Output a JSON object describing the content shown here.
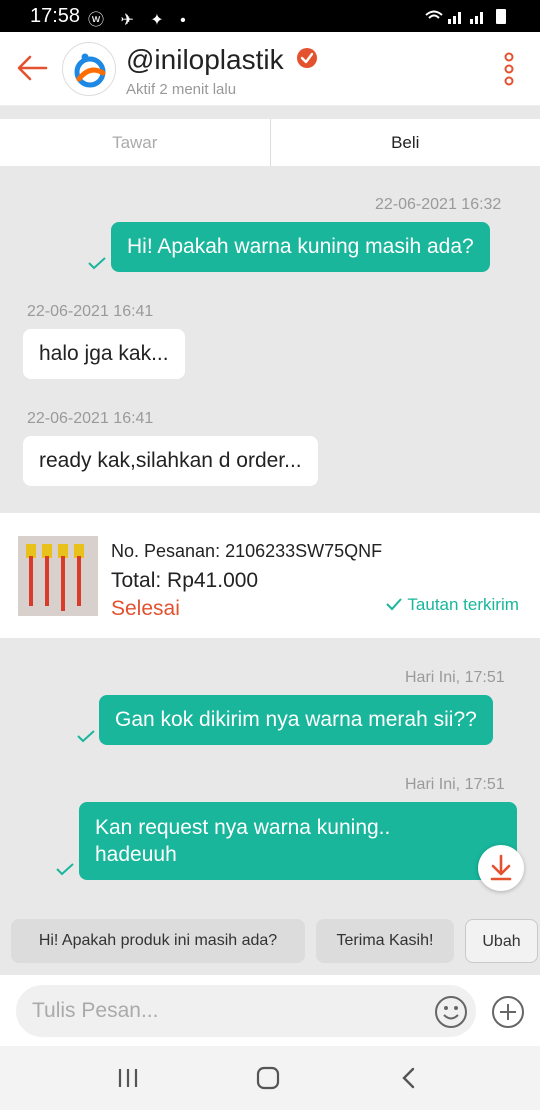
{
  "status_bar": {
    "time": "17:58",
    "notification_icons": "ⓦ ✈ ✦ •"
  },
  "header": {
    "shop_name": "@iniloplastik",
    "active_status": "Aktif 2 menit lalu"
  },
  "tabs": [
    {
      "label": "Tawar",
      "active": false
    },
    {
      "label": "Beli",
      "active": true
    }
  ],
  "messages": [
    {
      "timestamp": "22-06-2021 16:32",
      "text": "Hi! Apakah warna kuning masih ada?",
      "direction": "out"
    },
    {
      "timestamp": "22-06-2021 16:41",
      "text": "halo jga kak...",
      "direction": "in"
    },
    {
      "timestamp": "22-06-2021 16:41",
      "text": "ready kak,silahkan d order...",
      "direction": "in"
    },
    {
      "timestamp": "Hari Ini, 17:51",
      "text": "Gan kok dikirim nya warna merah sii??",
      "direction": "out"
    },
    {
      "timestamp": "Hari Ini, 17:51",
      "text": "Kan request nya warna kuning.. hadeuuh",
      "direction": "out"
    }
  ],
  "order_card": {
    "order_number": "No. Pesanan: 2106233SW75QNF",
    "total": "Total: Rp41.000",
    "status": "Selesai",
    "link_status": "Tautan terkirim"
  },
  "quick_replies": [
    "Hi! Apakah produk ini masih ada?",
    "Terima Kasih!",
    "Ubah"
  ],
  "composer": {
    "placeholder": "Tulis Pesan..."
  },
  "colors": {
    "accent": "#19b69c",
    "brand": "#e4512f",
    "background": "#e8e8e8"
  },
  "icons": [
    "back-arrow-icon",
    "verified-badge-icon",
    "more-vertical-icon",
    "check-icon",
    "download-icon",
    "emoji-icon",
    "plus-icon",
    "recents-icon",
    "home-icon",
    "nav-back-icon"
  ]
}
